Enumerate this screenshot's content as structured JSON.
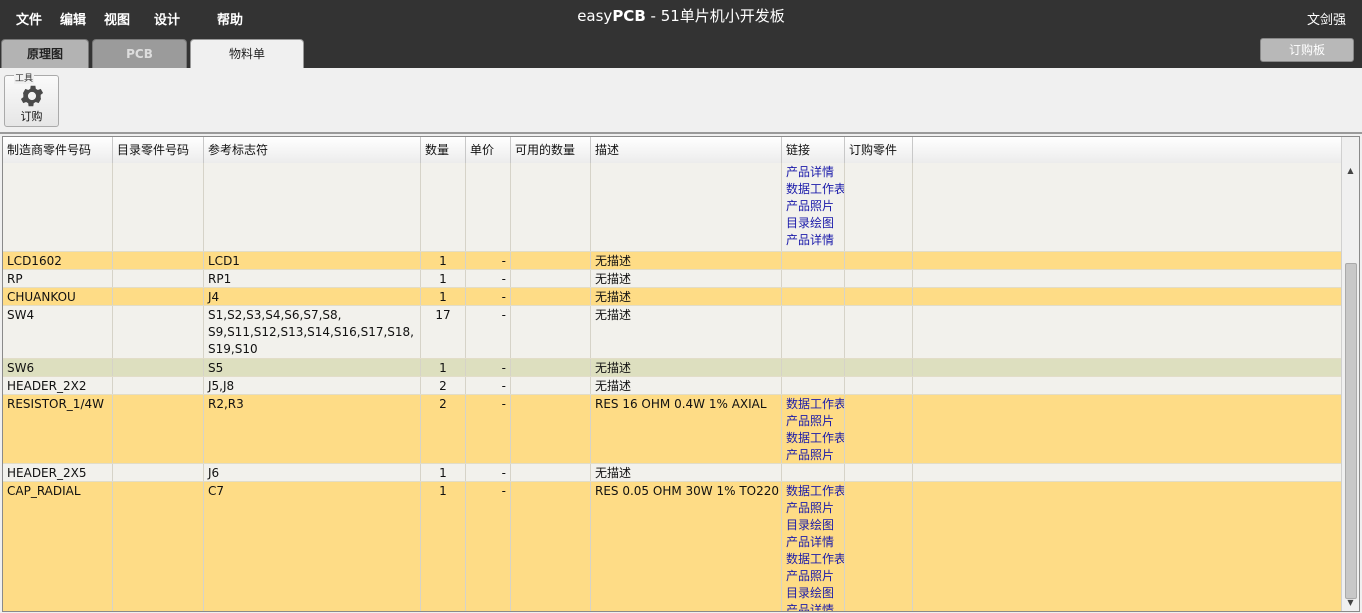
{
  "menu": [
    "文件",
    "编辑",
    "视图",
    "设计",
    "帮助"
  ],
  "title": {
    "brand_light": "easy",
    "brand_bold": "PCB",
    "rest": " - 51单片机小开发板"
  },
  "user": "文剑强",
  "tabs": [
    "原理图",
    "PCB",
    "物料单"
  ],
  "active_tab": "物料单",
  "order_board_label": "订购板",
  "toolbar": {
    "group_label": "工具",
    "order_label": "订购",
    "icon": "gear-icon"
  },
  "columns": [
    "制造商零件号码",
    "目录零件号码",
    "参考标志符",
    "数量",
    "单价",
    "可用的数量",
    "描述",
    "链接",
    "订购零件"
  ],
  "colors": {
    "row_highlight": "#fedc86",
    "row_default": "#f2f1ec",
    "row_selected": "#dddfbf",
    "link": "#1a1aaa",
    "titlebar": "#333333"
  },
  "rows": [
    {
      "mfr": "",
      "cat": "",
      "ref": "",
      "qty": "",
      "price": "",
      "avail": "",
      "desc": "",
      "links": [
        "产品详情",
        "数据工作表",
        "产品照片",
        "目录绘图",
        "产品详情"
      ],
      "order": ""
    },
    {
      "mfr": "LCD1602",
      "cat": "",
      "ref": "LCD1",
      "qty": "1",
      "price": "-",
      "avail": "",
      "desc": "无描述",
      "links": [],
      "order": ""
    },
    {
      "mfr": "RP",
      "cat": "",
      "ref": "RP1",
      "qty": "1",
      "price": "-",
      "avail": "",
      "desc": "无描述",
      "links": [],
      "order": ""
    },
    {
      "mfr": "CHUANKOU",
      "cat": "",
      "ref": "J4",
      "qty": "1",
      "price": "-",
      "avail": "",
      "desc": "无描述",
      "links": [],
      "order": ""
    },
    {
      "mfr": "SW4",
      "cat": "",
      "ref": "S1,S2,S3,S4,S6,S7,S8,\nS9,S11,S12,S13,S14,S16,S17,S18,\nS19,S10",
      "qty": "17",
      "price": "-",
      "avail": "",
      "desc": "无描述",
      "links": [],
      "order": ""
    },
    {
      "mfr": "SW6",
      "cat": "",
      "ref": "S5",
      "qty": "1",
      "price": "-",
      "avail": "",
      "desc": "无描述",
      "links": [],
      "order": ""
    },
    {
      "mfr": "HEADER_2X2",
      "cat": "",
      "ref": "J5,J8",
      "qty": "2",
      "price": "-",
      "avail": "",
      "desc": "无描述",
      "links": [],
      "order": ""
    },
    {
      "mfr": "RESISTOR_1/4W",
      "cat": "",
      "ref": "R2,R3",
      "qty": "2",
      "price": "-",
      "avail": "",
      "desc": "RES 16 OHM 0.4W 1% AXIAL",
      "links": [
        "数据工作表",
        "产品照片",
        "数据工作表",
        "产品照片"
      ],
      "order": ""
    },
    {
      "mfr": "HEADER_2X5",
      "cat": "",
      "ref": "J6",
      "qty": "1",
      "price": "-",
      "avail": "",
      "desc": "无描述",
      "links": [],
      "order": ""
    },
    {
      "mfr": "CAP_RADIAL",
      "cat": "",
      "ref": "C7",
      "qty": "1",
      "price": "-",
      "avail": "",
      "desc": "RES 0.05 OHM 30W 1% TO220",
      "links": [
        "数据工作表",
        "产品照片",
        "目录绘图",
        "产品详情",
        "数据工作表",
        "产品照片",
        "目录绘图",
        "产品详情"
      ],
      "order": ""
    }
  ]
}
